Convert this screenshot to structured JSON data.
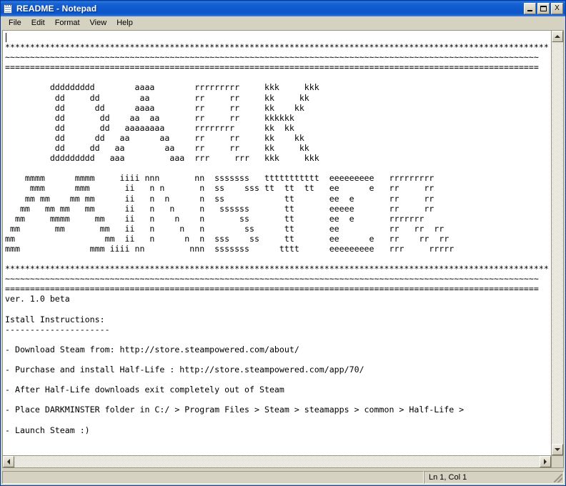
{
  "window": {
    "title": "README - Notepad",
    "icon": "notepad-icon",
    "buttons": {
      "minimize": "_",
      "maximize": "□",
      "close": "X"
    }
  },
  "menu": {
    "items": [
      {
        "label": "File"
      },
      {
        "label": "Edit"
      },
      {
        "label": "Format"
      },
      {
        "label": "View"
      },
      {
        "label": "Help"
      }
    ]
  },
  "editor": {
    "content": "\n*************************************************************************************************************\n~~~~~~~~~~~~~~~~~~~~~~~~~~~~~~~~~~~~~~~~~~~~~~~~~~~~~~~~~~~~~~~~~~~~~~~~~~~~~~~~~~~~~~~~~~~~~~~~~~~~~~~~~~~\n===========================================================================================================\n\n         ddddddddd        aaaa        rrrrrrrrr     kkk     kkk\n          dd     dd        aa         rr     rr     kk     kk\n          dd      dd      aaaa        rr     rr     kk    kk\n          dd       dd    aa  aa       rr     rr     kkkkkk\n          dd       dd   aaaaaaaa      rrrrrrrr      kk  kk\n          dd      dd   aa      aa     rr     rr     kk    kk\n          dd     dd   aa        aa    rr     rr     kk     kk\n         ddddddddd   aaa         aaa  rrr     rrr   kkk     kkk\n\n    mmmm      mmmm     iiii nnn       nn  sssssss   ttttttttttt  eeeeeeeee   rrrrrrrrr\n     mmm      mmm       ii   n n       n  ss    sss tt  tt  tt   ee      e   rr     rr\n    mm mm    mm mm      ii   n  n      n  ss            tt       ee  e       rr     rr\n   mm   mm mm   mm      ii   n   n     n   ssssss       tt       eeeee       rr     rr\n  mm     mmmm     mm    ii   n    n    n       ss       tt       ee  e       rrrrrrr\n mm       mm       mm   ii   n     n   n        ss      tt       ee          rr   rr  rr\nmm                  mm  ii   n      n  n  sss    ss     tt       ee      e   rr    rr  rr\nmmm              mmm iiii nn         nnn  sssssss      tttt      eeeeeeeee   rrr     rrrrr\n\n*************************************************************************************************************\n~~~~~~~~~~~~~~~~~~~~~~~~~~~~~~~~~~~~~~~~~~~~~~~~~~~~~~~~~~~~~~~~~~~~~~~~~~~~~~~~~~~~~~~~~~~~~~~~~~~~~~~~~~~\n===========================================================================================================\nver. 1.0 beta\n\nIstall Instructions:\n---------------------\n\n- Download Steam from: http://store.steampowered.com/about/\n\n- Purchase and install Half-Life : http://store.steampowered.com/app/70/\n\n- After Half-Life downloads exit completely out of Steam\n\n- Place DARKMINSTER folder in C:/ > Program Files > Steam > steamapps > common > Half-Life >\n\n- Launch Steam :)\n"
  },
  "scrollbars": {
    "vertical": {
      "up": "scroll-up-arrow",
      "down": "scroll-down-arrow"
    },
    "horizontal": {
      "left": "scroll-left-arrow",
      "right": "scroll-right-arrow"
    }
  },
  "statusbar": {
    "left": "",
    "position": "Ln 1, Col 1"
  },
  "colors": {
    "title_bar_blue": "#0f59ce",
    "window_face": "#d6d2c2",
    "editor_background": "#ffffff",
    "text": "#000000"
  }
}
